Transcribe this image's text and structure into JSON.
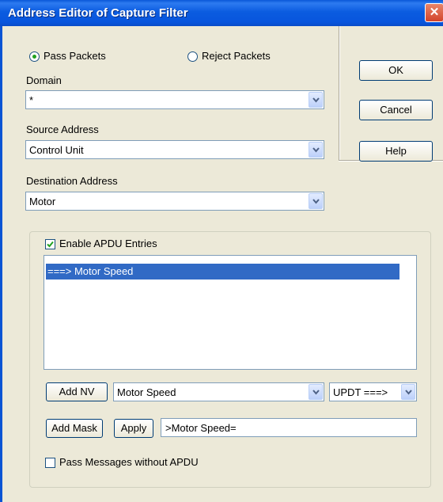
{
  "window": {
    "title": "Address Editor of Capture Filter",
    "close_glyph": "✕"
  },
  "mode": {
    "pass_label": "Pass Packets",
    "reject_label": "Reject Packets",
    "selected": "pass"
  },
  "domain": {
    "label": "Domain",
    "value": "*"
  },
  "source": {
    "label": "Source Address",
    "value": "Control Unit"
  },
  "destination": {
    "label": "Destination Address",
    "value": "Motor"
  },
  "buttons": {
    "ok": "OK",
    "cancel": "Cancel",
    "help": "Help"
  },
  "apdu": {
    "enable_label": "Enable APDU Entries",
    "enabled": true,
    "entries": [
      "===> Motor Speed"
    ],
    "selected_index": 0,
    "add_nv_label": "Add NV",
    "nv_value": "Motor Speed",
    "direction_value": "UPDT ===>",
    "add_mask_label": "Add Mask",
    "apply_label": "Apply",
    "mask_value": ">Motor Speed=",
    "pass_without_label": "Pass Messages without APDU",
    "pass_without_checked": false
  },
  "icons": {
    "radio": "radio-button",
    "dropdown": "chevron-down-icon",
    "check": "check-icon",
    "close": "close-icon"
  },
  "colors": {
    "title_bar": "#0a58d8",
    "dialog_bg": "#ece9d8",
    "selection": "#316ac5",
    "close_button": "#d2432a"
  }
}
